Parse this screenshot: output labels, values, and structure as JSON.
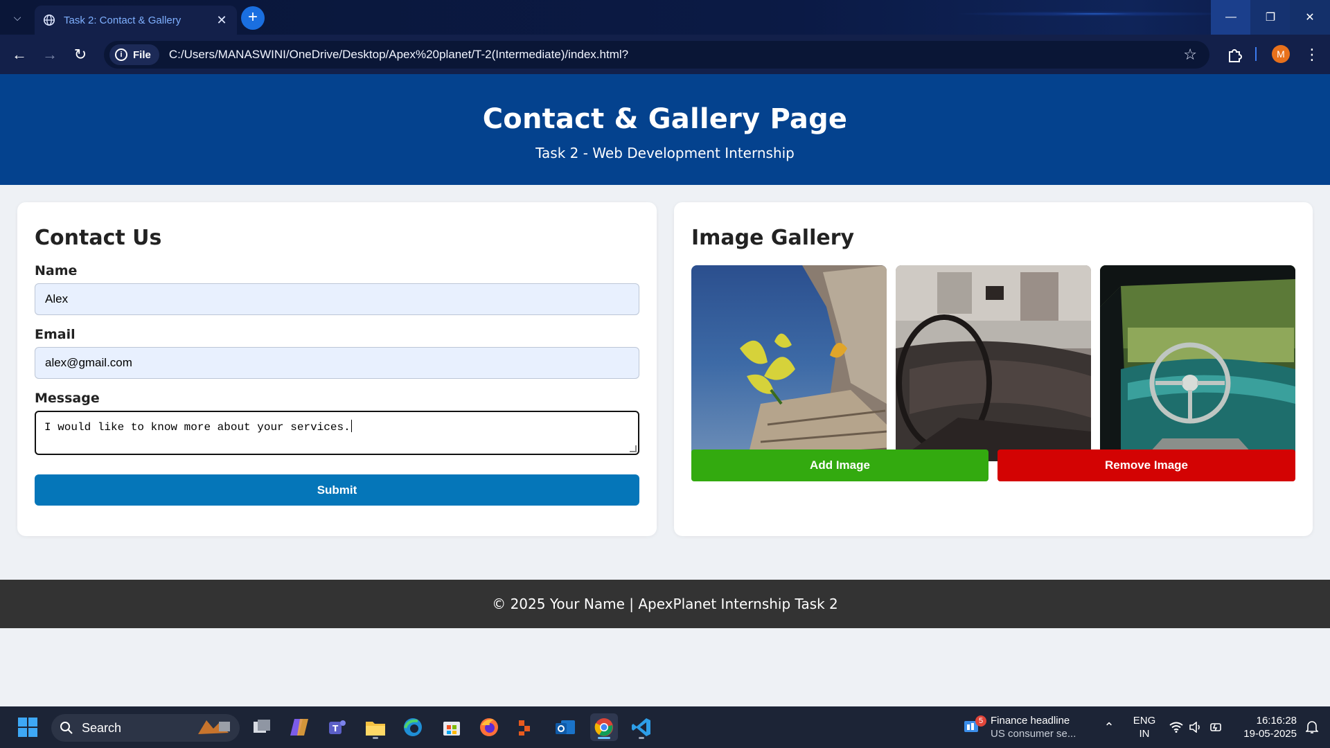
{
  "browser": {
    "tab_title": "Task 2: Contact & Gallery",
    "new_tab": "+",
    "chip_label": "File",
    "url": "C:/Users/MANASWINI/OneDrive/Desktop/Apex%20planet/T-2(Intermediate)/index.html?",
    "profile_initial": "M"
  },
  "header": {
    "title": "Contact & Gallery Page",
    "subtitle": "Task 2 - Web Development Internship"
  },
  "contact": {
    "heading": "Contact Us",
    "name_label": "Name",
    "name_value": "Alex",
    "email_label": "Email",
    "email_value": "alex@gmail.com",
    "message_label": "Message",
    "message_value": "I would like to know more about your services.",
    "submit_label": "Submit"
  },
  "gallery": {
    "heading": "Image Gallery",
    "images": [
      "yellow-flower-on-log",
      "vintage-car-dashboard",
      "teal-car-steering-wheel"
    ],
    "add_label": "Add Image",
    "remove_label": "Remove Image"
  },
  "footer": {
    "text": "© 2025 Your Name | ApexPlanet Internship Task 2"
  },
  "taskbar": {
    "search_label": "Search",
    "news_badge": "5",
    "news_title": "Finance headline",
    "news_sub": "US consumer se...",
    "lang_top": "ENG",
    "lang_bottom": "IN",
    "time": "16:16:28",
    "date": "19-05-2025"
  },
  "colors": {
    "header_bg": "#04428e",
    "submit_bg": "#0576b9",
    "add_bg": "#33aa0f",
    "remove_bg": "#d30303",
    "footer_bg": "#333333"
  }
}
